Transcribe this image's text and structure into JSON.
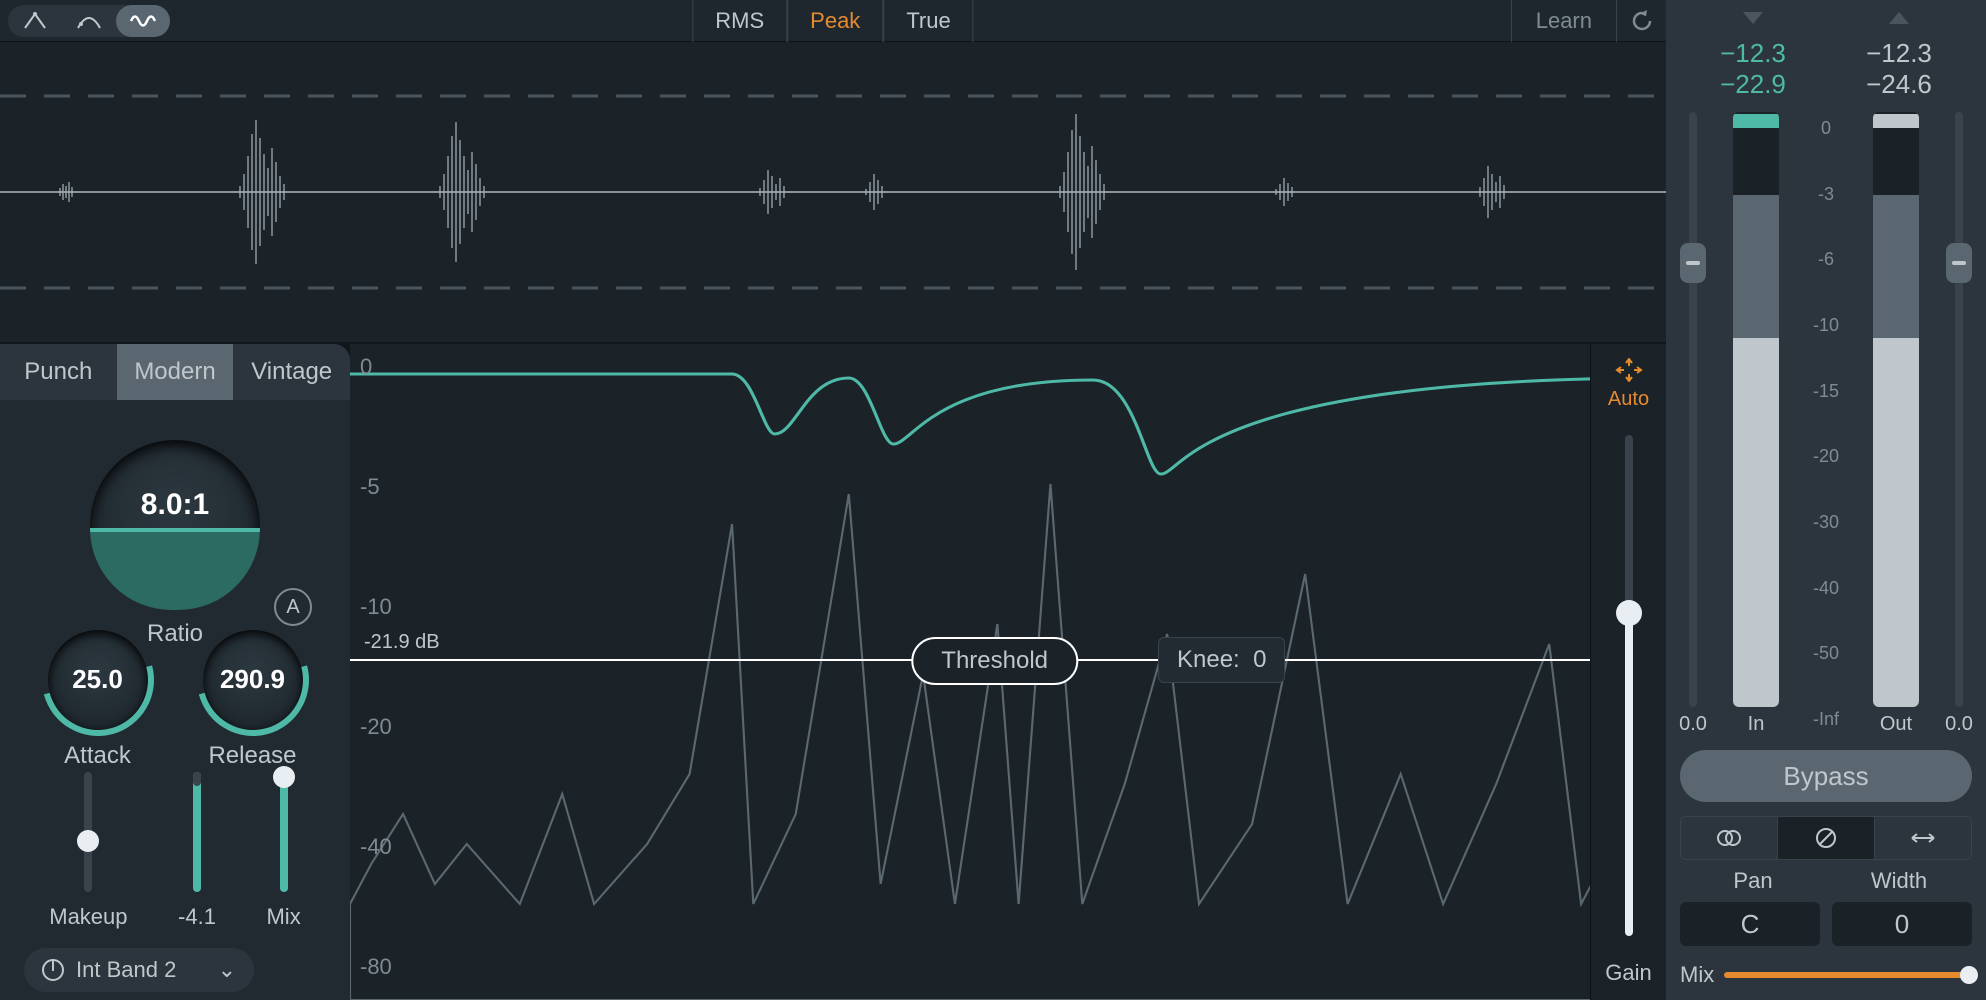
{
  "topbar": {
    "detect_tabs": [
      "RMS",
      "Peak",
      "True"
    ],
    "active_detect_index": 1,
    "learn_label": "Learn"
  },
  "style_tabs": {
    "items": [
      "Punch",
      "Modern",
      "Vintage"
    ],
    "active": 1
  },
  "ratio": {
    "value": "8.0:1",
    "label": "Ratio",
    "auto": "A"
  },
  "attack": {
    "value": "25.0",
    "label": "Attack"
  },
  "release": {
    "value": "290.9",
    "label": "Release"
  },
  "sliders": {
    "makeup": {
      "label": "Makeup"
    },
    "gainreadout": {
      "label": "-4.1"
    },
    "mix": {
      "label": "Mix"
    }
  },
  "band": {
    "name": "Int Band 2"
  },
  "graph": {
    "y_ticks": [
      "0",
      "-5",
      "-10",
      "-20",
      "-40",
      "-80"
    ],
    "threshold_db": "-21.9 dB",
    "threshold_label": "Threshold",
    "knee_label": "Knee:",
    "knee_value": "0"
  },
  "gain": {
    "auto_label": "Auto",
    "label": "Gain"
  },
  "side": {
    "in": {
      "peak": "−12.3",
      "rms": "−22.9",
      "label": "In",
      "slider": "0.0"
    },
    "out": {
      "peak": "−12.3",
      "rms": "−24.6",
      "label": "Out",
      "slider": "0.0"
    },
    "db_ticks": [
      "0",
      "-3",
      "-6",
      "-10",
      "-15",
      "-20",
      "-30",
      "-40",
      "-50",
      "-Inf"
    ],
    "bypass": "Bypass",
    "pan_label": "Pan",
    "pan_value": "C",
    "width_label": "Width",
    "width_value": "0",
    "mix_label": "Mix"
  }
}
